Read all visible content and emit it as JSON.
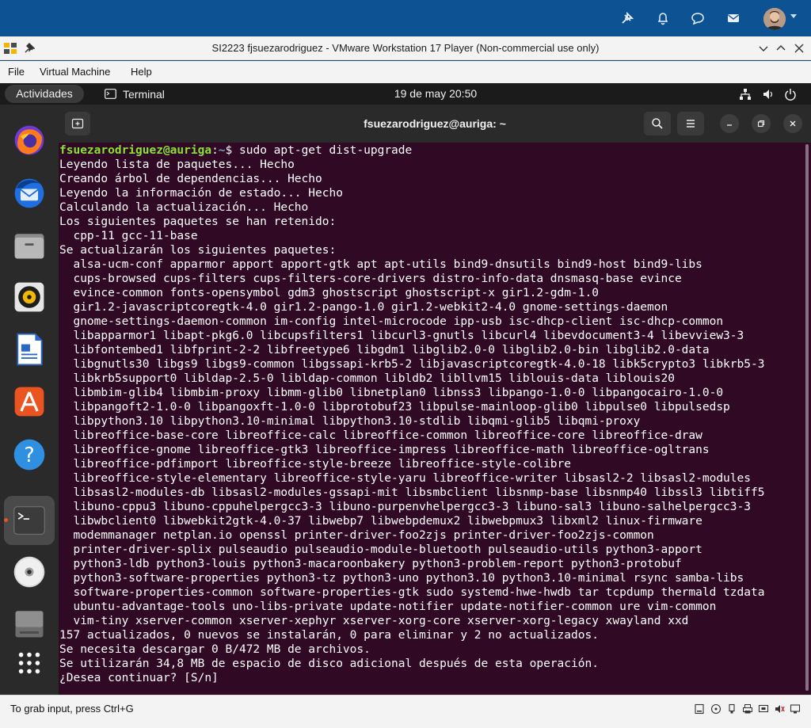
{
  "host_bar": {
    "icons": [
      "pin-icon",
      "bell-icon",
      "chat-icon",
      "mail-icon"
    ],
    "avatar": "avatar"
  },
  "vmware": {
    "title": "SI2223 fjsuezarodriguez - VMware Workstation 17 Player (Non-commercial use only)",
    "menu": [
      "File",
      "Virtual Machine",
      "Help"
    ]
  },
  "gnome_panel": {
    "activities": "Actividades",
    "app_name": "Terminal",
    "clock": "19 de may  20:50"
  },
  "dock": {
    "apps": [
      "firefox-icon",
      "thunderbird-icon",
      "files-icon",
      "rhythmbox-icon",
      "writer-icon",
      "app-center-icon",
      "help-icon",
      "terminal-icon",
      "cdrom-icon",
      "disk-icon",
      "show-apps-icon"
    ]
  },
  "terminal": {
    "title": "fsuezarodriguez@auriga: ~",
    "prompt_user": "fsuezarodriguez@auriga",
    "prompt_sep": ":",
    "prompt_path": "~",
    "prompt_symbol": "$ ",
    "command": "sudo apt-get dist-upgrade",
    "output": [
      "Leyendo lista de paquetes... Hecho",
      "Creando árbol de dependencias... Hecho",
      "Leyendo la información de estado... Hecho",
      "Calculando la actualización... Hecho",
      "Los siguientes paquetes se han retenido:",
      "  cpp-11 gcc-11-base",
      "Se actualizarán los siguientes paquetes:",
      "  alsa-ucm-conf apparmor apport apport-gtk apt apt-utils bind9-dnsutils bind9-host bind9-libs",
      "  cups-browsed cups-filters cups-filters-core-drivers distro-info-data dnsmasq-base evince",
      "  evince-common fonts-opensymbol gdm3 ghostscript ghostscript-x gir1.2-gdm-1.0",
      "  gir1.2-javascriptcoregtk-4.0 gir1.2-pango-1.0 gir1.2-webkit2-4.0 gnome-settings-daemon",
      "  gnome-settings-daemon-common im-config intel-microcode ipp-usb isc-dhcp-client isc-dhcp-common",
      "  libapparmor1 libapt-pkg6.0 libcupsfilters1 libcurl3-gnutls libcurl4 libevdocument3-4 libevview3-3",
      "  libfontembed1 libfprint-2-2 libfreetype6 libgdm1 libglib2.0-0 libglib2.0-bin libglib2.0-data",
      "  libgnutls30 libgs9 libgs9-common libgssapi-krb5-2 libjavascriptcoregtk-4.0-18 libk5crypto3 libkrb5-3",
      "  libkrb5support0 libldap-2.5-0 libldap-common libldb2 libllvm15 liblouis-data liblouis20",
      "  libmbim-glib4 libmbim-proxy libmm-glib0 libnetplan0 libnss3 libpango-1.0-0 libpangocairo-1.0-0",
      "  libpangoft2-1.0-0 libpangoxft-1.0-0 libprotobuf23 libpulse-mainloop-glib0 libpulse0 libpulsedsp",
      "  libpython3.10 libpython3.10-minimal libpython3.10-stdlib libqmi-glib5 libqmi-proxy",
      "  libreoffice-base-core libreoffice-calc libreoffice-common libreoffice-core libreoffice-draw",
      "  libreoffice-gnome libreoffice-gtk3 libreoffice-impress libreoffice-math libreoffice-ogltrans",
      "  libreoffice-pdfimport libreoffice-style-breeze libreoffice-style-colibre",
      "  libreoffice-style-elementary libreoffice-style-yaru libreoffice-writer libsasl2-2 libsasl2-modules",
      "  libsasl2-modules-db libsasl2-modules-gssapi-mit libsmbclient libsnmp-base libsnmp40 libssl3 libtiff5",
      "  libuno-cppu3 libuno-cppuhelpergcc3-3 libuno-purpenvhelpergcc3-3 libuno-sal3 libuno-salhelpergcc3-3",
      "  libwbclient0 libwebkit2gtk-4.0-37 libwebp7 libwebpdemux2 libwebpmux3 libxml2 linux-firmware",
      "  modemmanager netplan.io openssl printer-driver-foo2zjs printer-driver-foo2zjs-common",
      "  printer-driver-splix pulseaudio pulseaudio-module-bluetooth pulseaudio-utils python3-apport",
      "  python3-ldb python3-louis python3-macaroonbakery python3-problem-report python3-protobuf",
      "  python3-software-properties python3-tz python3-uno python3.10 python3.10-minimal rsync samba-libs",
      "  software-properties-common software-properties-gtk sudo systemd-hwe-hwdb tar tcpdump thermald tzdata",
      "  ubuntu-advantage-tools uno-libs-private update-notifier update-notifier-common ure vim-common",
      "  vim-tiny xserver-common xserver-xephyr xserver-xorg-core xserver-xorg-legacy xwayland xxd",
      "157 actualizados, 0 nuevos se instalarán, 0 para eliminar y 2 no actualizados.",
      "Se necesita descargar 0 B/472 MB de archivos.",
      "Se utilizarán 34,8 MB de espacio de disco adicional después de esta operación.",
      "¿Desea continuar? [S/n]"
    ]
  },
  "status_bar": {
    "text": "To grab input, press Ctrl+G",
    "device_icons": [
      "disk-device-icon",
      "cd-device-icon",
      "usb-device-icon",
      "printer-device-icon",
      "network-device-icon",
      "sound-device-icon",
      "display-device-icon"
    ]
  },
  "colors": {
    "terminal_bg": "#300a24",
    "prompt_user": "#8ae234",
    "prompt_path": "#729fcf",
    "host_bar": "#0d5293",
    "accent": "#e95420"
  }
}
